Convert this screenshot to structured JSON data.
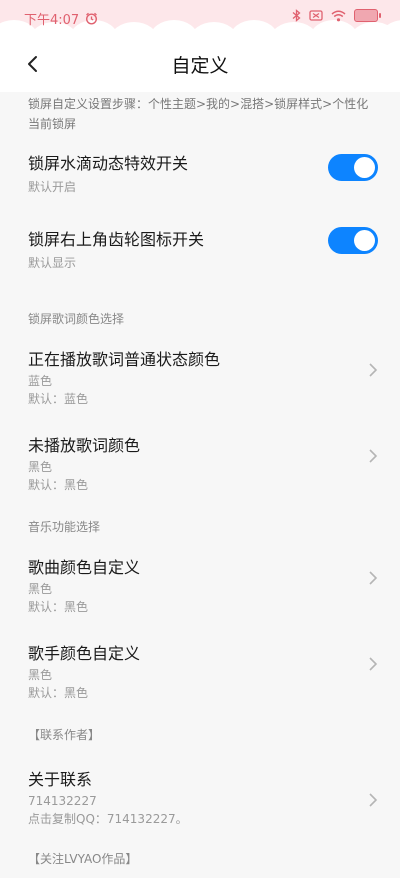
{
  "status_bar": {
    "time": "下午4:07"
  },
  "nav": {
    "title": "自定义"
  },
  "note": "锁屏自定义设置步骤：个性主题>我的>混搭>锁屏样式>个性化当前锁屏",
  "toggles": [
    {
      "title": "锁屏水滴动态特效开关",
      "subtitle": "默认开启",
      "on": true
    },
    {
      "title": "锁屏右上角齿轮图标开关",
      "subtitle": "默认显示",
      "on": true
    }
  ],
  "section_lyrics": "锁屏歌词颜色选择",
  "lyrics_rows": [
    {
      "title": "正在播放歌词普通状态颜色",
      "value": "蓝色",
      "default": "默认：蓝色"
    },
    {
      "title": "未播放歌词颜色",
      "value": "黑色",
      "default": "默认：黑色"
    }
  ],
  "section_music": "音乐功能选择",
  "music_rows": [
    {
      "title": "歌曲颜色自定义",
      "value": "黑色",
      "default": "默认：黑色"
    },
    {
      "title": "歌手颜色自定义",
      "value": "黑色",
      "default": "默认：黑色"
    }
  ],
  "section_contact": "【联系作者】",
  "contact_row": {
    "title": "关于联系",
    "value": "714132227",
    "action": "点击复制QQ：714132227。"
  },
  "section_follow": "【关注LVYAO作品】",
  "colors": {
    "accent": "#0d84ff",
    "status_pink": "#fde7ea",
    "status_text": "#e0616f"
  }
}
